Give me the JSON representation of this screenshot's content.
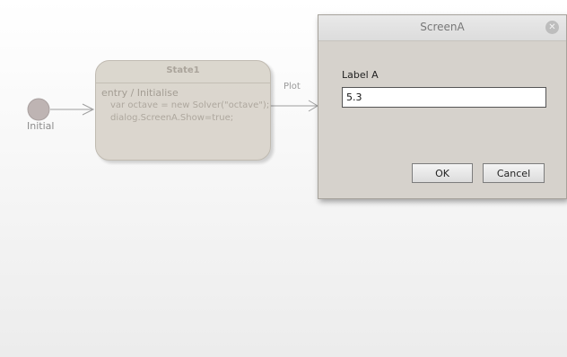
{
  "diagram": {
    "initial_label": "Initial",
    "transition_label": "Plot",
    "state": {
      "title": "State1",
      "entry": "entry / Initialise",
      "lines": [
        "var octave = new Solver(\"octave\");",
        "dialog.ScreenA.Show=true;"
      ]
    }
  },
  "dialog": {
    "title": "ScreenA",
    "field_label": "Label A",
    "field_value": "5.3",
    "ok_label": "OK",
    "cancel_label": "Cancel",
    "close_icon": "close-icon"
  }
}
